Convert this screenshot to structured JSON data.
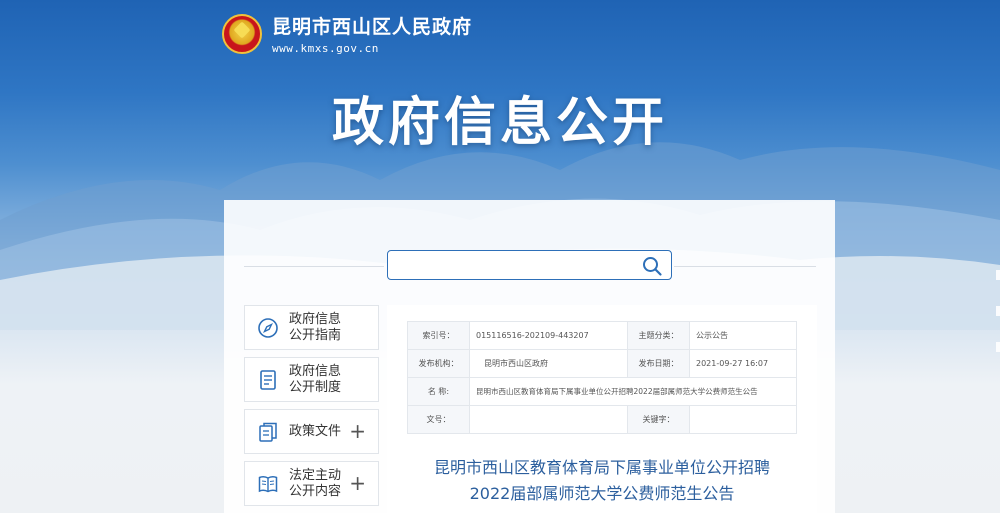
{
  "header": {
    "site_name": "昆明市西山区人民政府",
    "site_url": "www.kmxs.gov.cn",
    "page_title": "政府信息公开"
  },
  "search": {
    "placeholder": "",
    "value": ""
  },
  "sidebar": {
    "items": [
      {
        "label": "政府信息\n公开指南",
        "icon": "compass-icon",
        "has_plus": false
      },
      {
        "label": "政府信息\n公开制度",
        "icon": "document-icon",
        "has_plus": false
      },
      {
        "label": "政策文件",
        "icon": "files-icon",
        "has_plus": true
      },
      {
        "label": "法定主动\n公开内容",
        "icon": "book-icon",
        "has_plus": true
      }
    ],
    "plus_symbol": "+"
  },
  "meta": {
    "index_no_label": "索引号：",
    "index_no": "015116516-202109-443207",
    "category_label": "主题分类：",
    "category": "公示公告",
    "publisher_label": "发布机构：",
    "publisher": "昆明市西山区政府",
    "date_label": "发布日期：",
    "date": "2021-09-27 16:07",
    "name_label": "名 称:",
    "name": "昆明市西山区教育体育局下属事业单位公开招聘2022届部属师范大学公费师范生公告",
    "doc_no_label": "文号：",
    "doc_no": "",
    "keywords_label": "关键字：",
    "keywords": ""
  },
  "article": {
    "title_line1": "昆明市西山区教育体育局下属事业单位公开招聘",
    "title_line2": "2022届部属师范大学公费师范生公告"
  },
  "colors": {
    "brand_blue": "#2d6fb8",
    "title_blue": "#2c5f9e"
  }
}
